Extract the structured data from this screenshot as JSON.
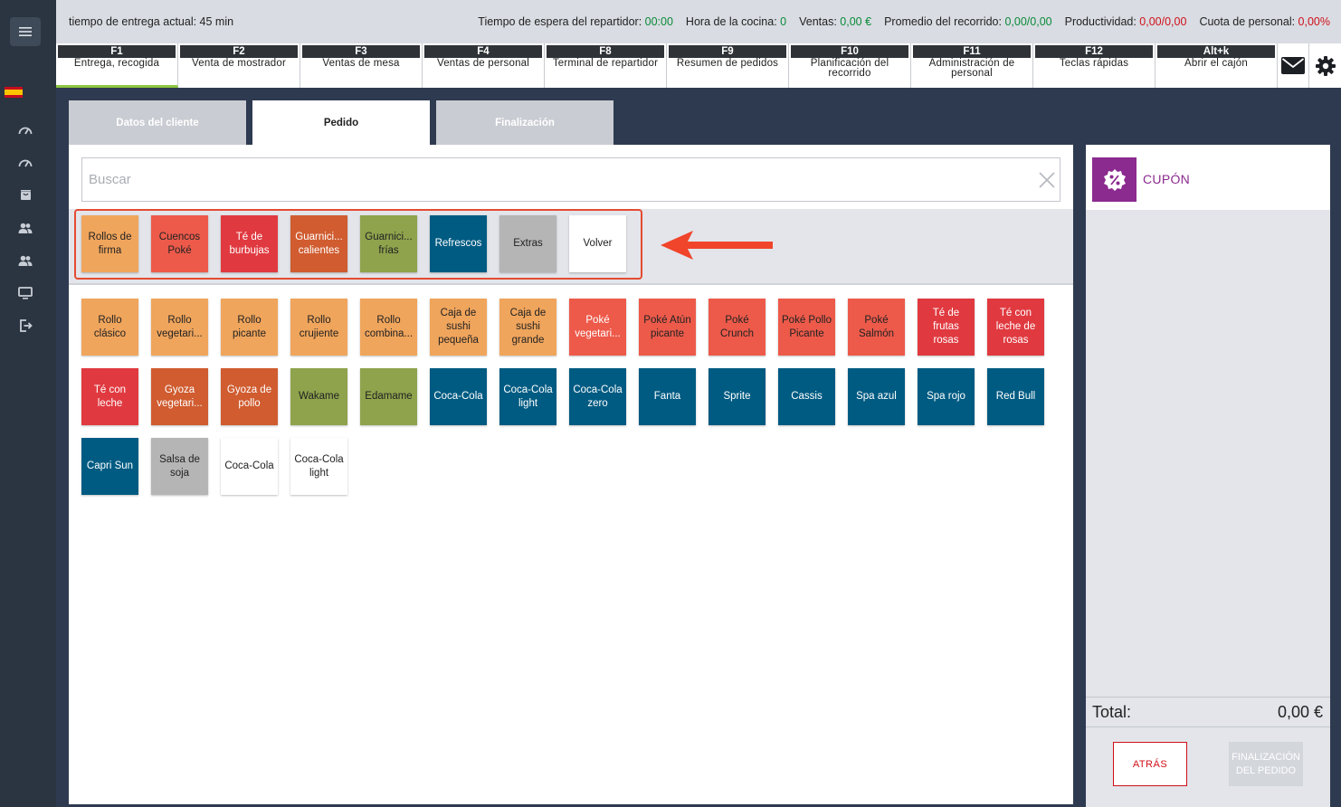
{
  "header": {
    "delivery_time": "tiempo de entrega actual:  45 min",
    "stats": [
      {
        "label": "Tiempo de espera del repartidor: ",
        "value": "00:00",
        "color": "#0a8a3a"
      },
      {
        "label": "Hora de la cocina: ",
        "value": "0",
        "color": "#0a8a3a"
      },
      {
        "label": "Ventas: ",
        "value": "0,00 €",
        "color": "#0a8a3a"
      },
      {
        "label": "Promedio del recorrido: ",
        "value": "0,00/0,00",
        "color": "#0a8a3a"
      },
      {
        "label": "Productividad: ",
        "value": "0,00/0,00",
        "color": "#d0101a"
      },
      {
        "label": "Cuota de personal: ",
        "value": "0,00%",
        "color": "#d0101a"
      }
    ]
  },
  "fkeys": [
    {
      "key": "F1",
      "label": "Entrega, recogida",
      "active": true
    },
    {
      "key": "F2",
      "label": "Venta de mostrador"
    },
    {
      "key": "F3",
      "label": "Ventas de mesa"
    },
    {
      "key": "F4",
      "label": "Ventas de personal"
    },
    {
      "key": "F8",
      "label": "Terminal de repartidor"
    },
    {
      "key": "F9",
      "label": "Resumen de pedidos"
    },
    {
      "key": "F10",
      "label": "Planificación del recorrido"
    },
    {
      "key": "F11",
      "label": "Administración de personal"
    },
    {
      "key": "F12",
      "label": "Teclas rápidas"
    },
    {
      "key": "Alt+k",
      "label": "Abrir el cajón"
    }
  ],
  "tabs": [
    "Datos del cliente",
    "Pedido",
    "Finalización"
  ],
  "search": {
    "placeholder": "Buscar",
    "value": ""
  },
  "categories": [
    {
      "label": "Rollos de firma",
      "color": "#f0a55c",
      "text": "#222"
    },
    {
      "label": "Cuencos Poké",
      "color": "#ed5a4a",
      "text": "#222"
    },
    {
      "label": "Té de burbujas",
      "color": "#e03a40",
      "text": "#fff"
    },
    {
      "label": "Guarnici... calientes",
      "color": "#d05c30",
      "text": "#fff"
    },
    {
      "label": "Guarnici... frías",
      "color": "#8ea34c",
      "text": "#222"
    },
    {
      "label": "Refrescos",
      "color": "#005b82",
      "text": "#fff"
    },
    {
      "label": "Extras",
      "color": "#b5b5b5",
      "text": "#222"
    },
    {
      "label": "Volver",
      "color": "#ffffff",
      "text": "#222"
    }
  ],
  "products": [
    {
      "label": "Rollo clásico",
      "color": "#f0a55c",
      "text": "#222"
    },
    {
      "label": "Rollo vegetari...",
      "color": "#f0a55c",
      "text": "#222"
    },
    {
      "label": "Rollo picante",
      "color": "#f0a55c",
      "text": "#222"
    },
    {
      "label": "Rollo crujiente",
      "color": "#f0a55c",
      "text": "#222"
    },
    {
      "label": "Rollo combina...",
      "color": "#f0a55c",
      "text": "#222"
    },
    {
      "label": "Caja de sushi pequeña",
      "color": "#f0a55c",
      "text": "#222"
    },
    {
      "label": "Caja de sushi grande",
      "color": "#f0a55c",
      "text": "#222"
    },
    {
      "label": "Poké vegetari...",
      "color": "#ed5a4a",
      "text": "#fff"
    },
    {
      "label": "Poké Atún picante",
      "color": "#ed5a4a",
      "text": "#222"
    },
    {
      "label": "Poké Crunch",
      "color": "#ed5a4a",
      "text": "#222"
    },
    {
      "label": "Poké Pollo Picante",
      "color": "#ed5a4a",
      "text": "#222"
    },
    {
      "label": "Poké Salmón",
      "color": "#ed5a4a",
      "text": "#222"
    },
    {
      "label": "Té de frutas rosas",
      "color": "#e03a40",
      "text": "#fff"
    },
    {
      "label": "Té con leche de rosas",
      "color": "#e03a40",
      "text": "#fff"
    },
    {
      "label": "Té con leche",
      "color": "#e03a40",
      "text": "#fff"
    },
    {
      "label": "Gyoza vegetari...",
      "color": "#d05c30",
      "text": "#fff"
    },
    {
      "label": "Gyoza de pollo",
      "color": "#d05c30",
      "text": "#fff"
    },
    {
      "label": "Wakame",
      "color": "#8ea34c",
      "text": "#222"
    },
    {
      "label": "Edamame",
      "color": "#8ea34c",
      "text": "#222"
    },
    {
      "label": "Coca-Cola",
      "color": "#005b82",
      "text": "#fff"
    },
    {
      "label": "Coca-Cola light",
      "color": "#005b82",
      "text": "#fff"
    },
    {
      "label": "Coca-Cola zero",
      "color": "#005b82",
      "text": "#fff"
    },
    {
      "label": "Fanta",
      "color": "#005b82",
      "text": "#fff"
    },
    {
      "label": "Sprite",
      "color": "#005b82",
      "text": "#fff"
    },
    {
      "label": "Cassis",
      "color": "#005b82",
      "text": "#fff"
    },
    {
      "label": "Spa azul",
      "color": "#005b82",
      "text": "#fff"
    },
    {
      "label": "Spa rojo",
      "color": "#005b82",
      "text": "#fff"
    },
    {
      "label": "Red Bull",
      "color": "#005b82",
      "text": "#fff"
    },
    {
      "label": "Capri Sun",
      "color": "#005b82",
      "text": "#fff"
    },
    {
      "label": "Salsa de soja",
      "color": "#b5b5b5",
      "text": "#222"
    },
    {
      "label": "Coca-Cola",
      "color": "#ffffff",
      "text": "#222"
    },
    {
      "label": "Coca-Cola light",
      "color": "#ffffff",
      "text": "#222"
    }
  ],
  "order": {
    "coupon_label": "CUPÓN",
    "total_label": "Total:",
    "total_value": "0,00 €",
    "back_label": "ATRÁS",
    "finish_label": "FINALIZACIÓN DEL PEDIDO"
  },
  "icons": {
    "menu": "hamburger-icon",
    "flag": "spain-flag-icon",
    "rail": [
      "speedometer-icon",
      "speedometer-icon",
      "bag-icon",
      "users-icon",
      "users-icon",
      "monitor-icon",
      "logout-icon"
    ],
    "mail": "envelope-icon",
    "settings": "gear-icon",
    "coupon": "percent-badge-icon",
    "clear": "close-icon"
  },
  "colors": {
    "accent_green": "#8dc63f",
    "alert_red": "#d0101a",
    "coupon_purple": "#8b2a8f",
    "highlight": "#e44b32"
  }
}
